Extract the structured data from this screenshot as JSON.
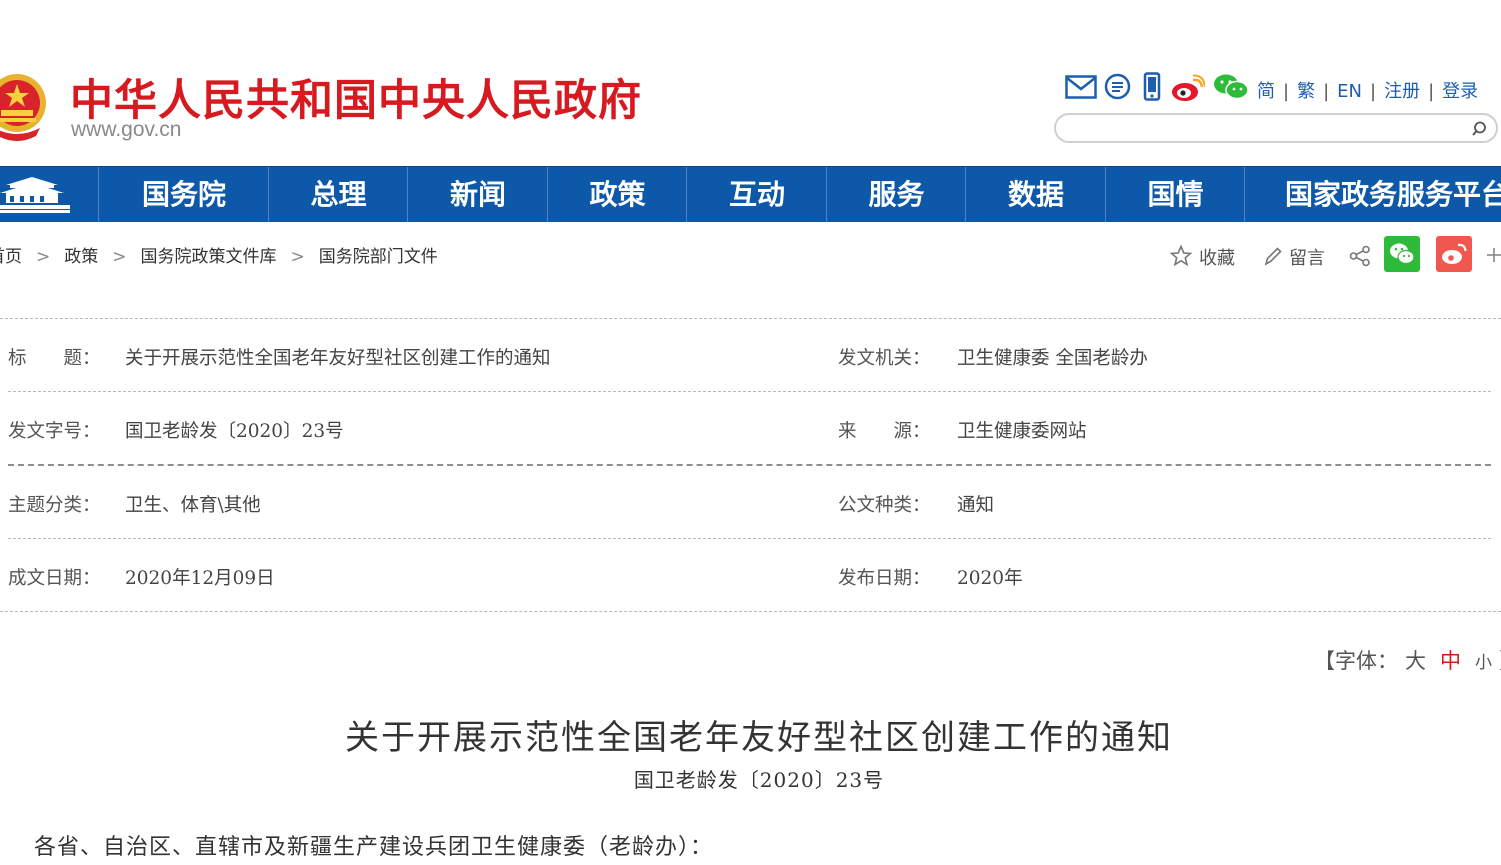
{
  "site": {
    "title": "中华人民共和国中央人民政府",
    "domain": "www.gov.cn"
  },
  "top_links": [
    "简",
    "繁",
    "EN",
    "注册",
    "登录"
  ],
  "top_icons": [
    "mail-icon",
    "message-icon",
    "mobile-icon",
    "weibo-icon",
    "wechat-icon"
  ],
  "search": {
    "placeholder": ""
  },
  "nav": {
    "items": [
      "国务院",
      "总理",
      "新闻",
      "政策",
      "互动",
      "服务",
      "数据",
      "国情",
      "国家政务服务平台"
    ]
  },
  "breadcrumb": [
    "首页",
    "政策",
    "国务院政策文件库",
    "国务院部门文件"
  ],
  "share": {
    "favorite": "收藏",
    "comment": "留言"
  },
  "meta": {
    "title_label": "标　　题：",
    "title_value": "关于开展示范性全国老年友好型社区创建工作的通知",
    "issuer_label": "发文机关：",
    "issuer_value": "卫生健康委  全国老龄办",
    "doc_no_label": "发文字号：",
    "doc_no_value": "国卫老龄发〔2020〕23号",
    "source_label": "来　　源：",
    "source_value": "卫生健康委网站",
    "topic_label": "主题分类：",
    "topic_value": "卫生、体育\\其他",
    "type_label": "公文种类：",
    "type_value": "通知",
    "written_label": "成文日期：",
    "written_value": "2020年12月09日",
    "published_label": "发布日期：",
    "published_value": "2020年"
  },
  "font_size": {
    "open": "【",
    "label": "字体：",
    "large": "大",
    "medium": "中",
    "small": "小",
    "close": "】"
  },
  "article": {
    "title": "关于开展示范性全国老年友好型社区创建工作的通知",
    "number": "国卫老龄发〔2020〕23号",
    "salutation": "各省、自治区、直辖市及新疆生产建设兵团卫生健康委（老龄办）："
  },
  "colors": {
    "brand_red": "#d71920",
    "nav_blue": "#0d58a8",
    "link_blue": "#1d5fae",
    "wechat_green": "#2dbb39",
    "weibo_red": "#f0574f"
  }
}
